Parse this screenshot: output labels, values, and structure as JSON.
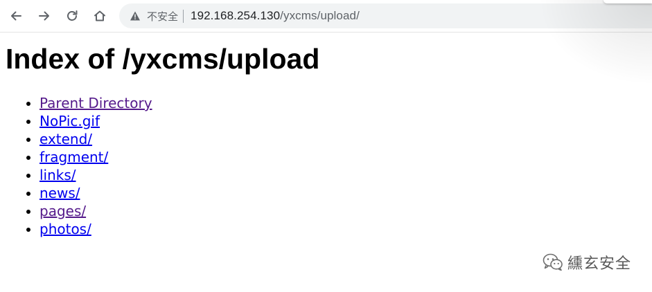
{
  "browser": {
    "security_label": "不安全",
    "url_host": "192.168.254.130",
    "url_path": "/yxcms/upload/",
    "icons": {
      "back": "arrow-left-icon",
      "forward": "arrow-right-icon",
      "reload": "reload-icon",
      "home": "home-icon",
      "security": "warning-triangle-icon"
    }
  },
  "page": {
    "title": "Index of /yxcms/upload",
    "links": [
      {
        "label": "Parent Directory",
        "visited": true
      },
      {
        "label": "NoPic.gif",
        "visited": false
      },
      {
        "label": "extend/",
        "visited": false
      },
      {
        "label": "fragment/",
        "visited": false
      },
      {
        "label": "links/",
        "visited": false
      },
      {
        "label": "news/",
        "visited": false
      },
      {
        "label": "pages/",
        "visited": true
      },
      {
        "label": "photos/",
        "visited": false
      }
    ]
  },
  "watermark": {
    "text": "纁玄安全",
    "icon": "wechat-icon"
  },
  "colors": {
    "link_unvisited": "#0000ee",
    "link_visited": "#551a8b",
    "omnibox_bg": "#f1f3f4"
  }
}
